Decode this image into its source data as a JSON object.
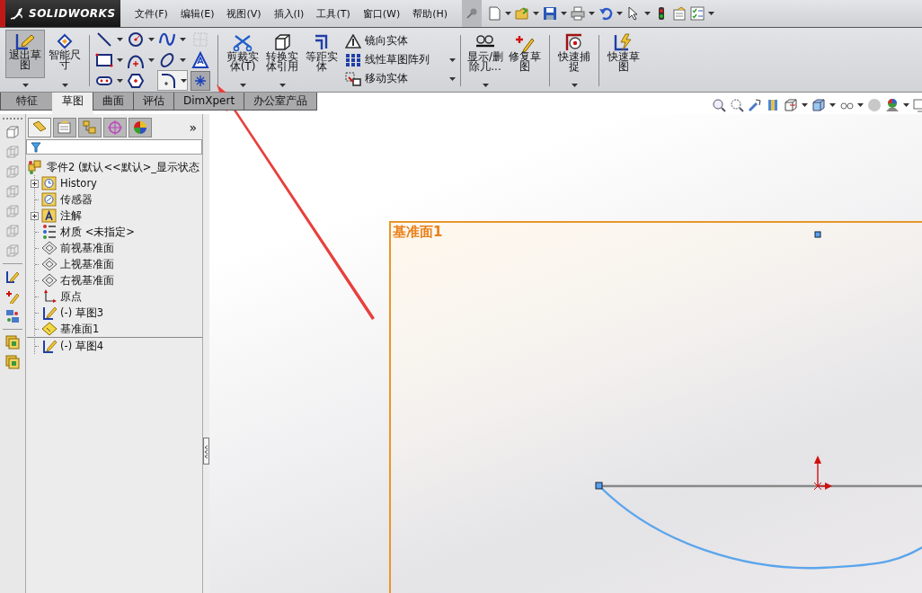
{
  "app": {
    "logo": "SOLIDWORKS"
  },
  "menu": [
    "文件(F)",
    "编辑(E)",
    "视图(V)",
    "插入(I)",
    "工具(T)",
    "窗口(W)",
    "帮助(H)"
  ],
  "ribbon": {
    "left_buttons": [
      {
        "label": "退出草图",
        "kind": "exit-sketch",
        "selected": true
      },
      {
        "label": "智能尺寸",
        "kind": "dimension",
        "selected": false
      }
    ],
    "sketch_tools": [
      {
        "kind": "line",
        "selected": false
      },
      {
        "kind": "circle",
        "selected": false
      },
      {
        "kind": "spline",
        "selected": false
      },
      {
        "kind": "grid",
        "selected": false
      },
      {
        "kind": "rectangle",
        "selected": false
      },
      {
        "kind": "arc",
        "selected": false
      },
      {
        "kind": "ellipse",
        "selected": false
      },
      {
        "kind": "text",
        "selected": false
      },
      {
        "kind": "slot",
        "selected": false
      },
      {
        "kind": "polygon",
        "selected": false
      },
      {
        "kind": "fillet",
        "selected": false
      },
      {
        "kind": "point",
        "selected": true
      }
    ],
    "mid_buttons": [
      {
        "label": "剪裁实体(T)",
        "kind": "trim",
        "selected": false
      },
      {
        "label": "转换实体引用",
        "kind": "convert",
        "selected": false
      },
      {
        "label": "等距实体",
        "kind": "offset",
        "selected": false
      }
    ],
    "commands": [
      {
        "label": "镜向实体",
        "kind": "mirror"
      },
      {
        "label": "线性草图阵列",
        "kind": "pattern"
      },
      {
        "label": "移动实体",
        "kind": "move"
      }
    ],
    "right_buttons": [
      {
        "label": "显示/删除几...",
        "kind": "relations",
        "selected": false
      },
      {
        "label": "修复草图",
        "kind": "repair",
        "selected": false
      },
      {
        "label": "快速捕捉",
        "kind": "snap",
        "selected": false
      },
      {
        "label": "快速草图",
        "kind": "quick-sketch",
        "selected": false
      }
    ]
  },
  "tabs": [
    {
      "label": "特征",
      "selected": false
    },
    {
      "label": "草图",
      "selected": true
    },
    {
      "label": "曲面",
      "selected": false
    },
    {
      "label": "评估",
      "selected": false
    },
    {
      "label": "DimXpert",
      "selected": false
    },
    {
      "label": "办公室产品",
      "selected": false
    }
  ],
  "feature_manager": {
    "tabs": [
      {
        "kind": "tree",
        "selected": true
      },
      {
        "kind": "property",
        "selected": false
      },
      {
        "kind": "config",
        "selected": false
      },
      {
        "kind": "dimxpert",
        "selected": false
      },
      {
        "kind": "display",
        "selected": false
      }
    ],
    "more": "»",
    "tree": {
      "label": "零件2  (默认<<默认>_显示状态",
      "kind": "part",
      "children": [
        {
          "label": "History",
          "kind": "history",
          "expanded": false
        },
        {
          "label": "传感器",
          "kind": "sensor"
        },
        {
          "label": "注解",
          "kind": "annotation",
          "expanded": false
        },
        {
          "label": "材质 <未指定>",
          "kind": "material"
        },
        {
          "label": "前视基准面",
          "kind": "plane"
        },
        {
          "label": "上视基准面",
          "kind": "plane"
        },
        {
          "label": "右视基准面",
          "kind": "plane"
        },
        {
          "label": "原点",
          "kind": "origin"
        },
        {
          "label": "(-) 草图3",
          "kind": "sketch"
        },
        {
          "label": "基准面1",
          "kind": "ref-plane"
        },
        {
          "label": "(-) 草图4",
          "kind": "sketch"
        }
      ]
    }
  },
  "canvas": {
    "plane_label": "基准面1"
  }
}
